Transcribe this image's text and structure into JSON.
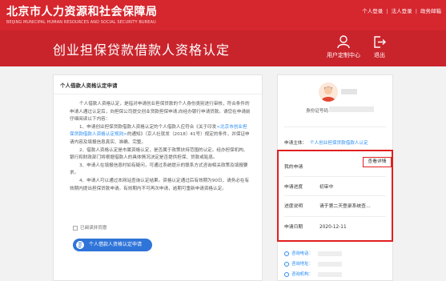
{
  "header": {
    "logo_cn": "北京市人力资源和社会保障局",
    "logo_en": "BEIJING MUNICIPAL HUMAN RESOURCES AND SOCIAL SECURITY BUREAU",
    "links": [
      "个人登录",
      "法人登录",
      "政务邮箱"
    ],
    "separator": "|"
  },
  "banner": {
    "title": "创业担保贷款借款人资格认定",
    "user_center": "用户定制中心",
    "logout": "退出"
  },
  "left": {
    "section_title": "个人借款人资格认定申请",
    "paragraphs": [
      "个人借款人资格认定，是指对申请创业担保贷款的个人身份类别进行审核，符合条件的申请人通过认定后，向担保公司提交创业贷款担保申请,向经办银行申请贷款。请您在申请前仔细阅读以下内容：",
      "1、申请创业担保贷款借款人资格认定的个人借款人应符合《关于印发<北京市创业担保贷款借款人资格认定规则>的通知》（京人社就发〔2018〕41号）规定的条件，并保证申请内容及填报信息真实、准确、完整。",
      "2、借款人资格认定是市属资格认定，是否属于政策扶持范围的认定。经办担保机构、银行和财政部门将根据借款人的具体情况决定是否提供担保、贷款或贴息。",
      "3、申请人在填报信息时如有疑问，可通过系统提示的联系方式咨询相关政策及填报要求。",
      "4、申请人可以通过本网站查询认定结果。资格认定通过后有效期为90日，请务必在有效期内提出担保贷款申请。有效期内不可再次申请，逾期可重新申请资格认定。"
    ],
    "link_text": "<北京市创业担保贷款借款人资格认定规则>",
    "agree_label": "已阅读并同意",
    "apply_button": "个人借款人资格认定申请"
  },
  "right": {
    "id_label": "身份证号码：",
    "apply_label": "申请主体：",
    "apply_value": "个人创业担保贷款借款人认定",
    "my_apply": "我的申请",
    "detail_button": "查看详情",
    "rows": [
      {
        "k": "申请进度",
        "v": "初审中"
      },
      {
        "k": "进度说明",
        "v": "请于第二天登录系统查…"
      },
      {
        "k": "申请日期",
        "v": "2020-12-11"
      }
    ],
    "consult": [
      "咨询电话：",
      "咨询地址：",
      "咨询机构："
    ]
  }
}
